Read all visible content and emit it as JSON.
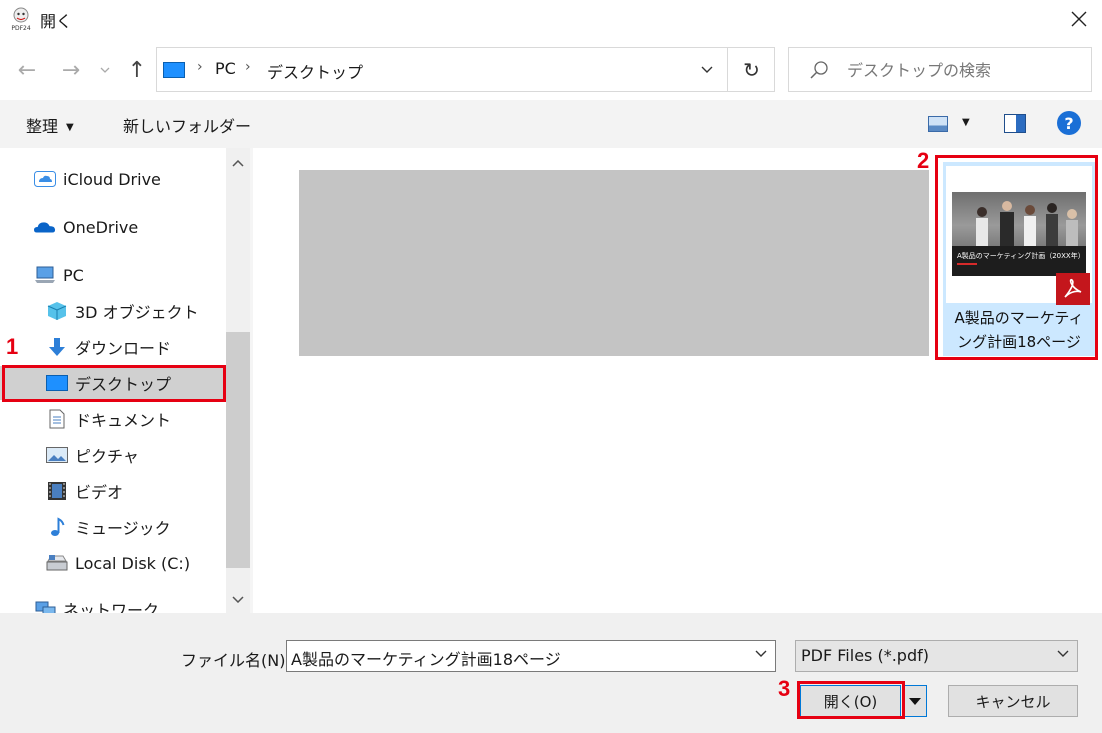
{
  "window": {
    "title": "開く",
    "app_icon": "pdf24-icon"
  },
  "nav": {
    "back": "←",
    "forward": "→",
    "up": "↑"
  },
  "address": {
    "crumbs": [
      "PC",
      "デスクトップ"
    ],
    "refresh": "↻"
  },
  "search": {
    "placeholder": "デスクトップの検索"
  },
  "toolbar": {
    "organize": "整理",
    "new_folder": "新しいフォルダー",
    "help": "?"
  },
  "sidebar": {
    "items": [
      {
        "label": "iCloud Drive",
        "icon": "icloud-icon"
      },
      {
        "label": "OneDrive",
        "icon": "onedrive-icon"
      },
      {
        "label": "PC",
        "icon": "pc-icon"
      },
      {
        "label": "3D オブジェクト",
        "icon": "3d-objects-icon"
      },
      {
        "label": "ダウンロード",
        "icon": "download-icon"
      },
      {
        "label": "デスクトップ",
        "icon": "desktop-icon",
        "selected": true
      },
      {
        "label": "ドキュメント",
        "icon": "document-icon"
      },
      {
        "label": "ピクチャ",
        "icon": "pictures-icon"
      },
      {
        "label": "ビデオ",
        "icon": "video-icon"
      },
      {
        "label": "ミュージック",
        "icon": "music-icon"
      },
      {
        "label": "Local Disk (C:)",
        "icon": "local-disk-icon"
      },
      {
        "label": "ネットワーク",
        "icon": "network-icon"
      }
    ]
  },
  "content": {
    "file": {
      "name": "A製品のマーケティング計画18ページ",
      "name_line1": "A製品のマーケティ",
      "name_line2": "ング計画18ページ",
      "thumb_title": "A製品のマーケティング計画（20XX年）"
    }
  },
  "footer": {
    "filename_label": "ファイル名(N):",
    "filename_value": "A製品のマーケティング計画18ページ",
    "filetype_value": "PDF Files (*.pdf)",
    "open_label": "開く(O)",
    "cancel_label": "キャンセル"
  },
  "annotations": [
    "1",
    "2",
    "3"
  ],
  "colors": {
    "accent": "#0078d7",
    "highlight": "#e60012",
    "selection": "#cce8ff"
  }
}
